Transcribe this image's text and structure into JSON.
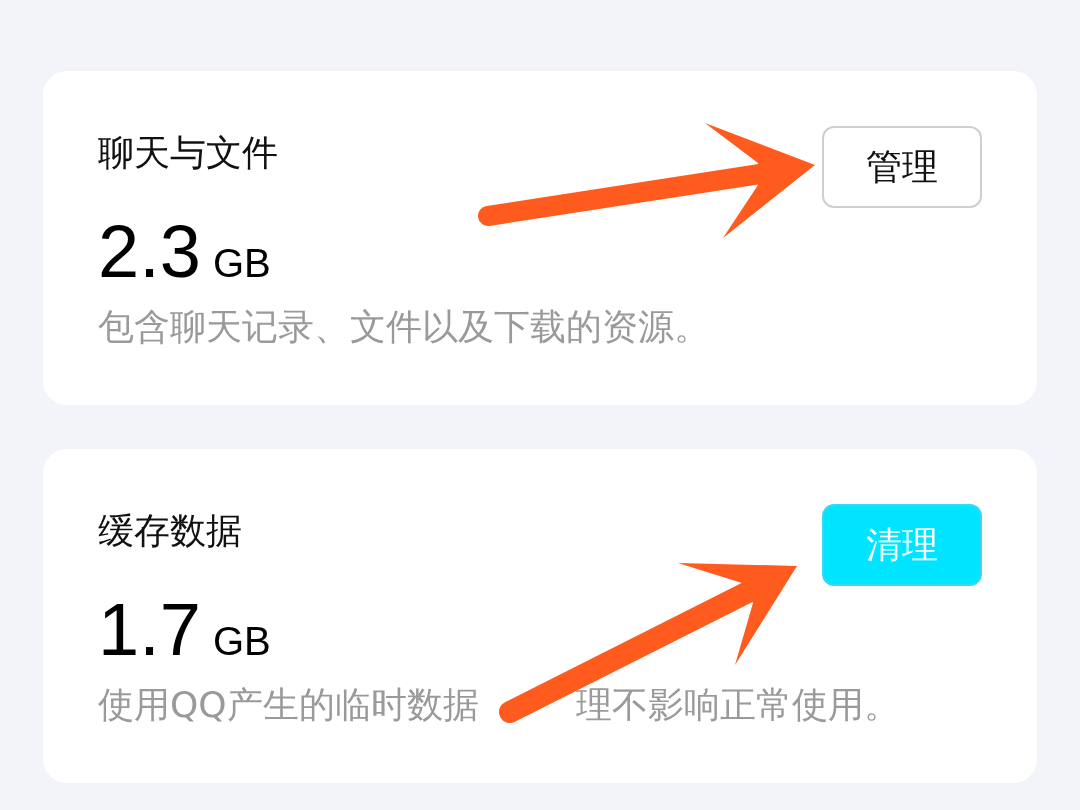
{
  "sections": [
    {
      "title": "聊天与文件",
      "size": "2.3",
      "unit": "GB",
      "description": [
        "包含聊天记录、文件以及下载的资源。"
      ],
      "button": {
        "label": "管理",
        "kind": "outline"
      }
    },
    {
      "title": "缓存数据",
      "size": "1.7",
      "unit": "GB",
      "description": [
        "使用QQ产生的临时数据",
        "理不影响正常使用。"
      ],
      "button": {
        "label": "清理",
        "kind": "filled"
      }
    }
  ]
}
